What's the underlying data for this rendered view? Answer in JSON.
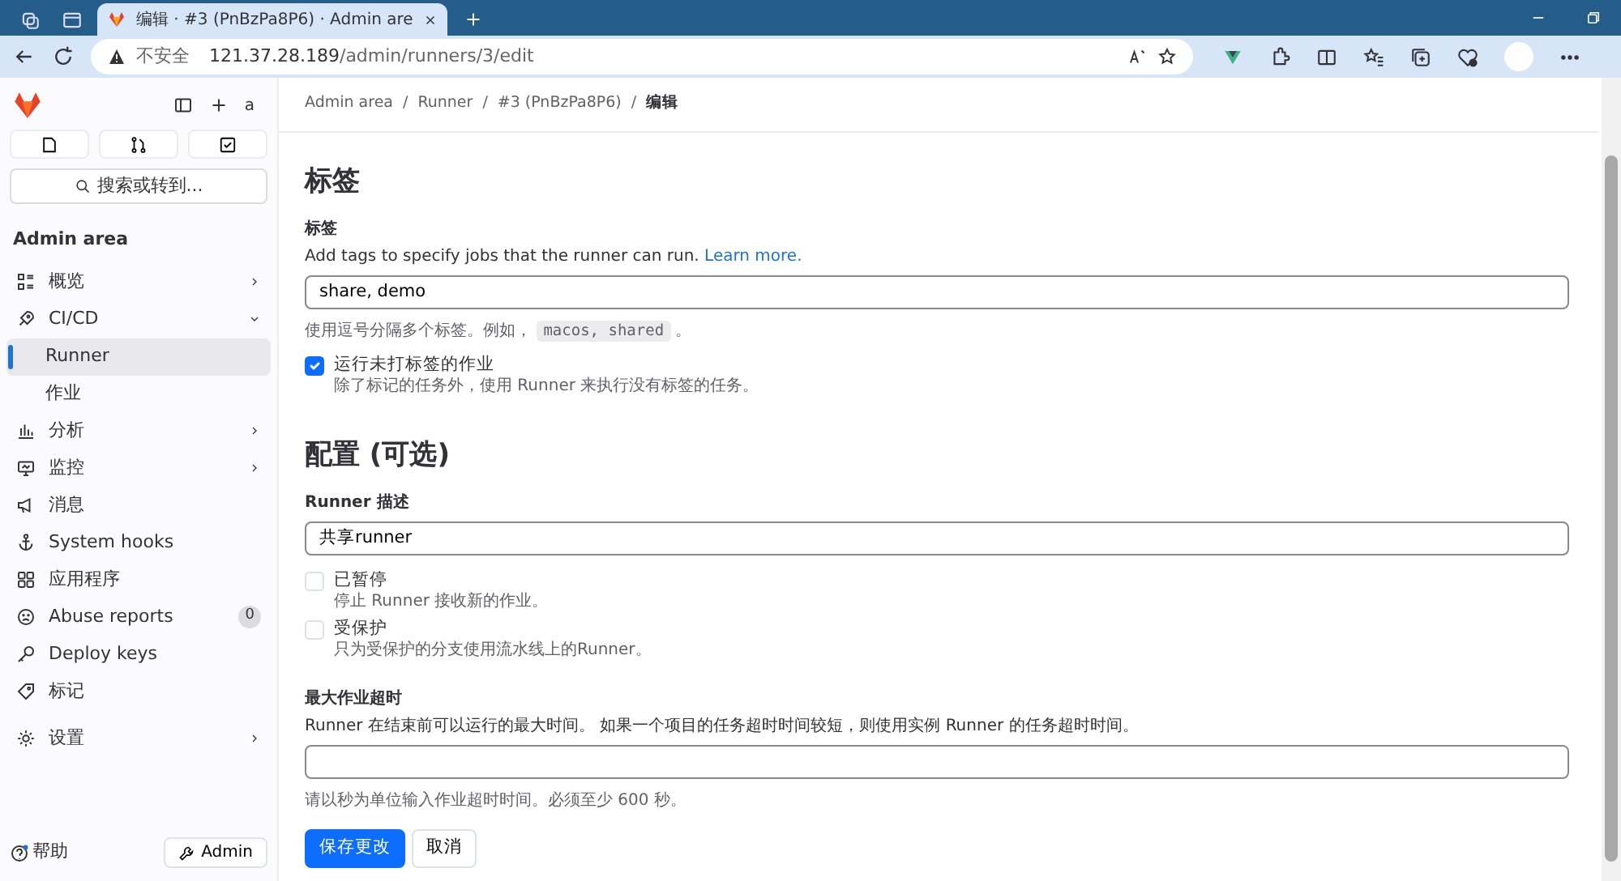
{
  "browser": {
    "tabs": [
      {
        "title": "编辑 · #3 (PnBzPa8P6) · Admin are",
        "selected": true
      }
    ],
    "security": "不安全",
    "url_host": "121.37.28.189",
    "url_path": "/admin/runners/3/edit"
  },
  "sidebar": {
    "avatar_alt": "a",
    "search": "搜索或转到...",
    "section": "Admin area",
    "items": [
      {
        "label": "概览",
        "kind": "item",
        "selected": false,
        "expanded": false
      },
      {
        "label": "CI/CD",
        "kind": "item",
        "selected": false,
        "expanded": true
      },
      {
        "label": "Runner",
        "kind": "subitem",
        "selected": true
      },
      {
        "label": "作业",
        "kind": "subitem",
        "selected": false
      },
      {
        "label": "分析",
        "kind": "item",
        "selected": false,
        "expanded": false
      },
      {
        "label": "监控",
        "kind": "item",
        "selected": false,
        "expanded": false
      },
      {
        "label": "消息",
        "kind": "item",
        "selected": false
      },
      {
        "label": "System hooks",
        "kind": "item",
        "selected": false
      },
      {
        "label": "应用程序",
        "kind": "item",
        "selected": false
      },
      {
        "label": "Abuse reports",
        "kind": "item",
        "selected": false,
        "badge": "0"
      },
      {
        "label": "Deploy keys",
        "kind": "item",
        "selected": false
      },
      {
        "label": "标记",
        "kind": "item",
        "selected": false
      },
      {
        "label": "设置",
        "kind": "item",
        "selected": false,
        "expanded": false
      }
    ],
    "help": "帮助",
    "admin_button": "Admin"
  },
  "breadcrumbs": [
    "Admin area",
    "Runner",
    "#3 (PnBzPa8P6)",
    "编辑"
  ],
  "breadcrumb_separator": "/",
  "tags_section": {
    "title": "标签",
    "label": "标签",
    "help": "Add tags to specify jobs that the runner can run.",
    "help_link": "Learn more.",
    "value": "share, demo",
    "hint": "使用逗号分隔多个标签。例如，",
    "hint_code": "macos, shared",
    "hint_end": "。",
    "checkbox": {
      "label": "运行未打标签的作业",
      "description": "除了标记的任务外，使用 Runner 来执行没有标签的任务。",
      "checked": true
    }
  },
  "config_section": {
    "title": "配置 (可选)",
    "description_label": "Runner 描述",
    "description_value": "共享runner",
    "checkboxes": [
      {
        "label": "已暂停",
        "description": "停止 Runner 接收新的作业。",
        "checked": false
      },
      {
        "label": "受保护",
        "description": "只为受保护的分支使用流水线上的Runner。",
        "checked": false
      }
    ],
    "timeout_label": "最大作业超时",
    "timeout_help": "Runner 在结束前可以运行的最大时间。 如果一个项目的任务超时时间较短，则使用实例 Runner 的任务超时时间。",
    "timeout_hint": "请以秒为单位输入作业超时时间。必须至少 600 秒。"
  },
  "buttons": [
    {
      "label": "保存更改",
      "kind": "primary"
    },
    {
      "label": "取消",
      "kind": "secondary"
    }
  ]
}
